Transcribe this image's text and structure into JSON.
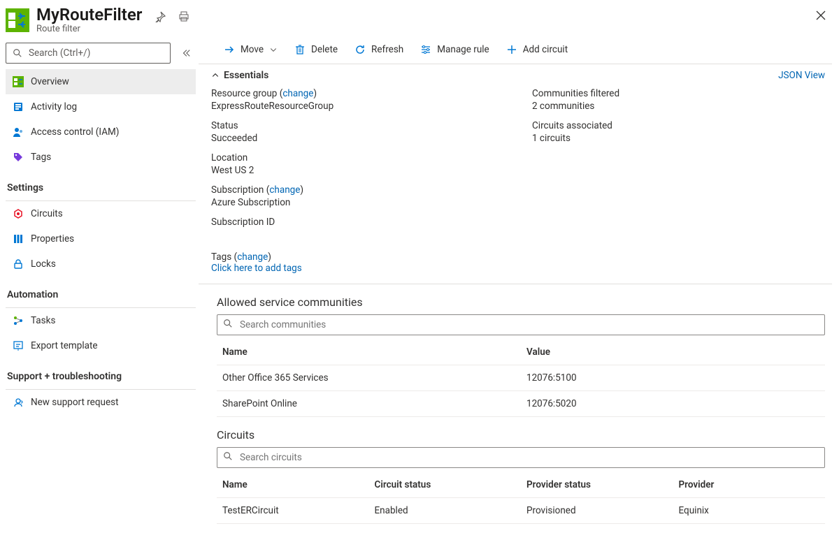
{
  "header": {
    "title": "MyRouteFilter",
    "subtitle": "Route filter"
  },
  "sidebar": {
    "search_placeholder": "Search (Ctrl+/)",
    "items": [
      {
        "label": "Overview"
      },
      {
        "label": "Activity log"
      },
      {
        "label": "Access control (IAM)"
      },
      {
        "label": "Tags"
      }
    ],
    "groups": [
      {
        "title": "Settings",
        "items": [
          {
            "label": "Circuits"
          },
          {
            "label": "Properties"
          },
          {
            "label": "Locks"
          }
        ]
      },
      {
        "title": "Automation",
        "items": [
          {
            "label": "Tasks"
          },
          {
            "label": "Export template"
          }
        ]
      },
      {
        "title": "Support + troubleshooting",
        "items": [
          {
            "label": "New support request"
          }
        ]
      }
    ]
  },
  "toolbar": {
    "move": "Move",
    "delete": "Delete",
    "refresh": "Refresh",
    "manage_rule": "Manage rule",
    "add_circuit": "Add circuit"
  },
  "essentials": {
    "section_label": "Essentials",
    "json_view": "JSON View",
    "change": "change",
    "resource_group": {
      "label": "Resource group",
      "value": "ExpressRouteResourceGroup"
    },
    "status": {
      "label": "Status",
      "value": "Succeeded"
    },
    "location": {
      "label": "Location",
      "value": "West US 2"
    },
    "subscription": {
      "label": "Subscription",
      "value": "Azure Subscription"
    },
    "subscription_id": {
      "label": "Subscription ID",
      "value": ""
    },
    "communities_filtered": {
      "label": "Communities filtered",
      "value": "2 communities"
    },
    "circuits_associated": {
      "label": "Circuits associated",
      "value": "1 circuits"
    },
    "tags": {
      "label": "Tags",
      "add_link": "Click here to add tags"
    }
  },
  "communities": {
    "title": "Allowed service communities",
    "search_placeholder": "Search communities",
    "columns": [
      "Name",
      "Value"
    ],
    "rows": [
      {
        "name": "Other Office 365 Services",
        "value": "12076:5100"
      },
      {
        "name": "SharePoint Online",
        "value": "12076:5020"
      }
    ]
  },
  "circuits": {
    "title": "Circuits",
    "search_placeholder": "Search circuits",
    "columns": [
      "Name",
      "Circuit status",
      "Provider status",
      "Provider"
    ],
    "rows": [
      {
        "name": "TestERCircuit",
        "circuit_status": "Enabled",
        "provider_status": "Provisioned",
        "provider": "Equinix"
      }
    ]
  }
}
